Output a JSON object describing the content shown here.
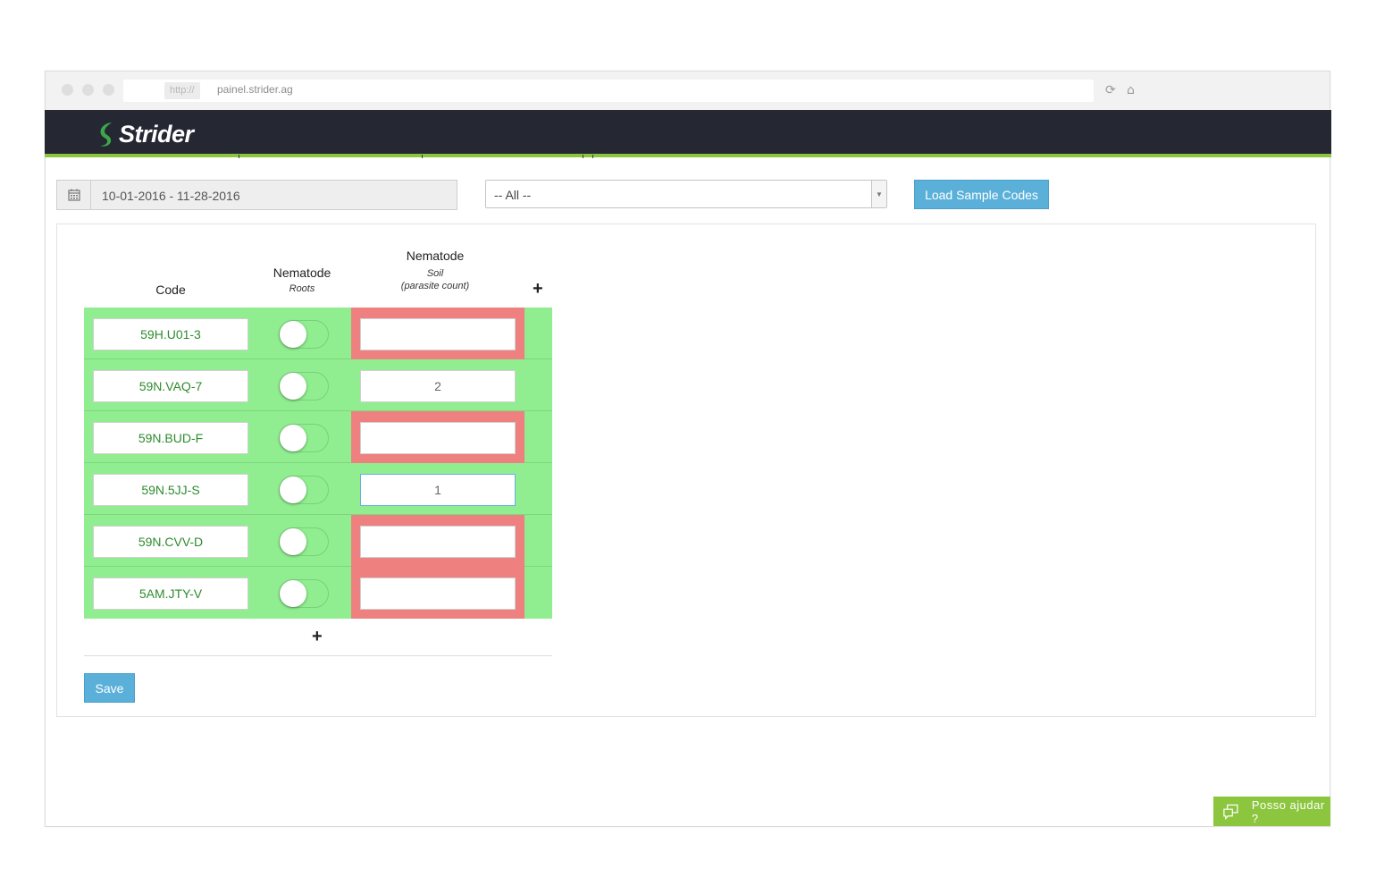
{
  "browser": {
    "protocol": "http://",
    "url": "painel.strider.ag",
    "back_icon": "chevron-left-icon",
    "forward_icon": "chevron-right-icon",
    "reload_icon": "reload-icon",
    "home_icon": "home-icon"
  },
  "app": {
    "logo_text": "Strider",
    "brand_color": "#8cc63f",
    "header_bg": "#252733"
  },
  "filters": {
    "date_range": "10-01-2016 - 11-28-2016",
    "select_value": "-- All --",
    "load_button": "Load Sample Codes"
  },
  "table": {
    "headers": {
      "code": "Code",
      "roots_title": "Nematode",
      "roots_sub": "Roots",
      "soil_title": "Nematode",
      "soil_sub_1": "Soil",
      "soil_sub_2": "(parasite count)"
    },
    "add_column_label": "+",
    "add_row_label": "+",
    "rows": [
      {
        "code": "59H.U01-3",
        "roots": false,
        "soil": "",
        "soil_error": true
      },
      {
        "code": "59N.VAQ-7",
        "roots": false,
        "soil": "2",
        "soil_error": false
      },
      {
        "code": "59N.BUD-F",
        "roots": false,
        "soil": "",
        "soil_error": true
      },
      {
        "code": "59N.5JJ-S",
        "roots": false,
        "soil": "1",
        "soil_error": false
      },
      {
        "code": "59N.CVV-D",
        "roots": false,
        "soil": "",
        "soil_error": true
      },
      {
        "code": "5AM.JTY-V",
        "roots": false,
        "soil": "",
        "soil_error": true
      }
    ],
    "row_color": "#90ee90",
    "error_color": "#ee8080"
  },
  "actions": {
    "save": "Save"
  },
  "help": {
    "label": "Posso ajudar ?",
    "icon": "chat-icon"
  }
}
